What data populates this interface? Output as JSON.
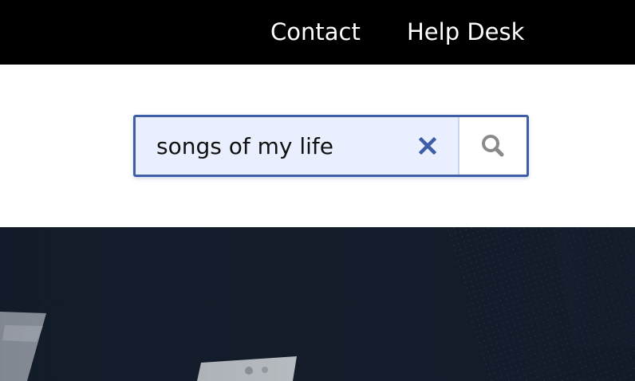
{
  "nav": {
    "links": [
      {
        "label": "Contact"
      },
      {
        "label": "Help Desk"
      }
    ]
  },
  "search": {
    "value": "songs of my life",
    "clear_icon": "close-icon",
    "submit_icon": "search-icon"
  },
  "colors": {
    "nav_background": "#000000",
    "nav_text": "#ffffff",
    "search_border": "#3f5ea8",
    "search_field_background": "#e9efff",
    "clear_icon": "#3f5ea8",
    "search_icon": "#8a8a8a",
    "hero_background": "#111a28"
  },
  "hero": {
    "image": "dark-music-studio-background"
  }
}
